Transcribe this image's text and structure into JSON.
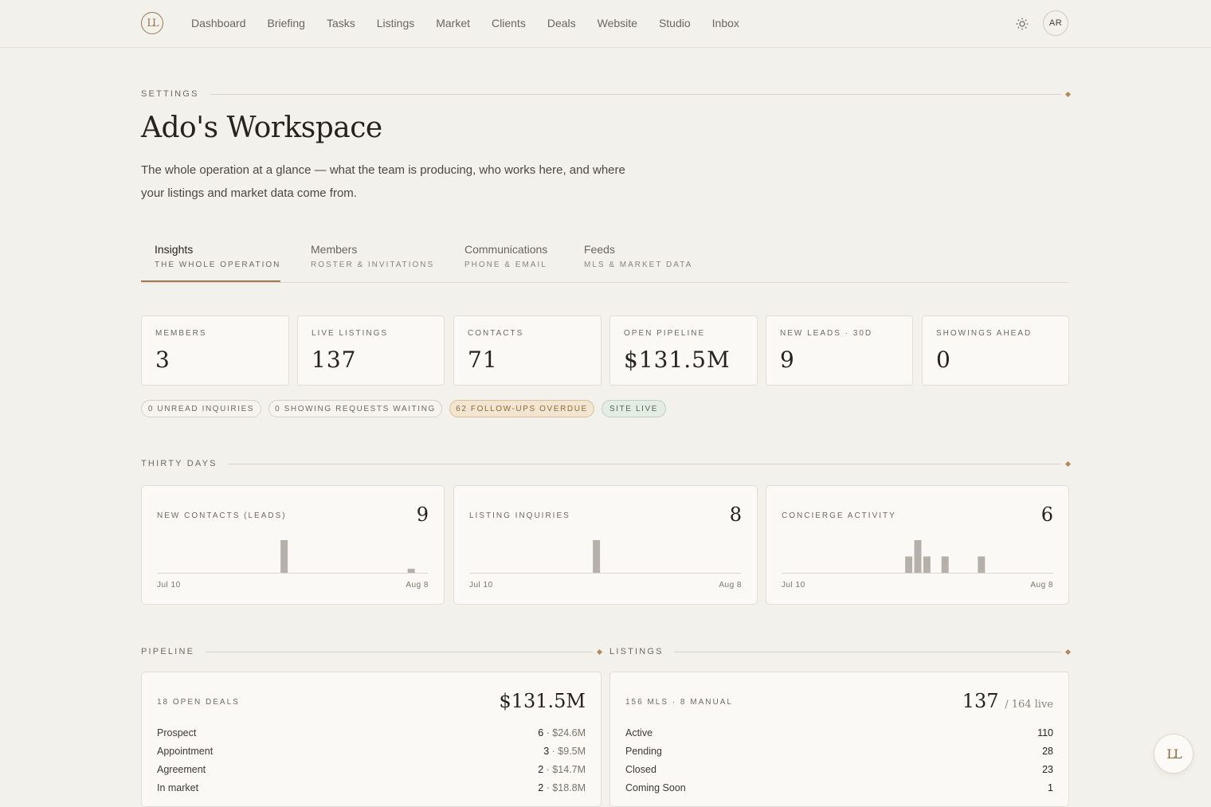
{
  "brand": {
    "logo_text": "LL",
    "accent": "#a17a52"
  },
  "nav": {
    "items": [
      "Dashboard",
      "Briefing",
      "Tasks",
      "Listings",
      "Market",
      "Clients",
      "Deals",
      "Website",
      "Studio",
      "Inbox"
    ],
    "theme_icon": "sun-icon",
    "avatar": "AR"
  },
  "header": {
    "eyebrow": "SETTINGS",
    "title": "Ado's Workspace",
    "description": "The whole operation at a glance — what the team is producing, who works here, and where your listings and market data come from."
  },
  "tabs": [
    {
      "label": "Insights",
      "sub": "THE WHOLE OPERATION",
      "active": true
    },
    {
      "label": "Members",
      "sub": "ROSTER & INVITATIONS",
      "active": false
    },
    {
      "label": "Communications",
      "sub": "PHONE & EMAIL",
      "active": false
    },
    {
      "label": "Feeds",
      "sub": "MLS & MARKET DATA",
      "active": false
    }
  ],
  "stats": [
    {
      "label": "MEMBERS",
      "value": "3"
    },
    {
      "label": "LIVE LISTINGS",
      "value": "137"
    },
    {
      "label": "CONTACTS",
      "value": "71"
    },
    {
      "label": "OPEN PIPELINE",
      "value": "$131.5M"
    },
    {
      "label": "NEW LEADS · 30D",
      "value": "9"
    },
    {
      "label": "SHOWINGS AHEAD",
      "value": "0"
    }
  ],
  "chips": [
    {
      "label": "0 UNREAD INQUIRIES",
      "status": "neutral"
    },
    {
      "label": "0 SHOWING REQUESTS WAITING",
      "status": "neutral"
    },
    {
      "label": "62 FOLLOW-UPS OVERDUE",
      "status": "warn"
    },
    {
      "label": "SITE LIVE",
      "status": "ok"
    }
  ],
  "thirty_days": {
    "heading": "THIRTY DAYS",
    "cards": [
      {
        "label": "NEW CONTACTS (LEADS)",
        "value": "9",
        "start": "Jul 10",
        "end": "Aug 8"
      },
      {
        "label": "LISTING INQUIRIES",
        "value": "8",
        "start": "Jul 10",
        "end": "Aug 8"
      },
      {
        "label": "CONCIERGE ACTIVITY",
        "value": "6",
        "start": "Jul 10",
        "end": "Aug 8"
      }
    ]
  },
  "chart_data": [
    {
      "type": "bar",
      "title": "NEW CONTACTS (LEADS)",
      "x_start": "Jul 10",
      "x_end": "Aug 8",
      "days": 30,
      "bars": [
        {
          "day": 14,
          "value": 8
        },
        {
          "day": 28,
          "value": 1
        }
      ]
    },
    {
      "type": "bar",
      "title": "LISTING INQUIRIES",
      "x_start": "Jul 10",
      "x_end": "Aug 8",
      "days": 30,
      "bars": [
        {
          "day": 14,
          "value": 8
        }
      ]
    },
    {
      "type": "bar",
      "title": "CONCIERGE ACTIVITY",
      "x_start": "Jul 10",
      "x_end": "Aug 8",
      "days": 30,
      "bars": [
        {
          "day": 14,
          "value": 1
        },
        {
          "day": 15,
          "value": 2
        },
        {
          "day": 16,
          "value": 1
        },
        {
          "day": 18,
          "value": 1
        },
        {
          "day": 22,
          "value": 1
        }
      ]
    }
  ],
  "pipeline": {
    "heading": "PIPELINE",
    "label": "18 OPEN DEALS",
    "total": "$131.5M",
    "rows": [
      {
        "stage": "Prospect",
        "count": "6",
        "amount": "$24.6M"
      },
      {
        "stage": "Appointment",
        "count": "3",
        "amount": "$9.5M"
      },
      {
        "stage": "Agreement",
        "count": "2",
        "amount": "$14.7M"
      },
      {
        "stage": "In market",
        "count": "2",
        "amount": "$18.8M"
      }
    ]
  },
  "listings": {
    "heading": "LISTINGS",
    "label": "156 MLS · 8 MANUAL",
    "total": "137",
    "total_sub": "/ 164 live",
    "rows": [
      {
        "status": "Active",
        "count": "110"
      },
      {
        "status": "Pending",
        "count": "28"
      },
      {
        "status": "Closed",
        "count": "23"
      },
      {
        "status": "Coming Soon",
        "count": "1"
      }
    ]
  },
  "fab": {
    "text": "LL"
  }
}
